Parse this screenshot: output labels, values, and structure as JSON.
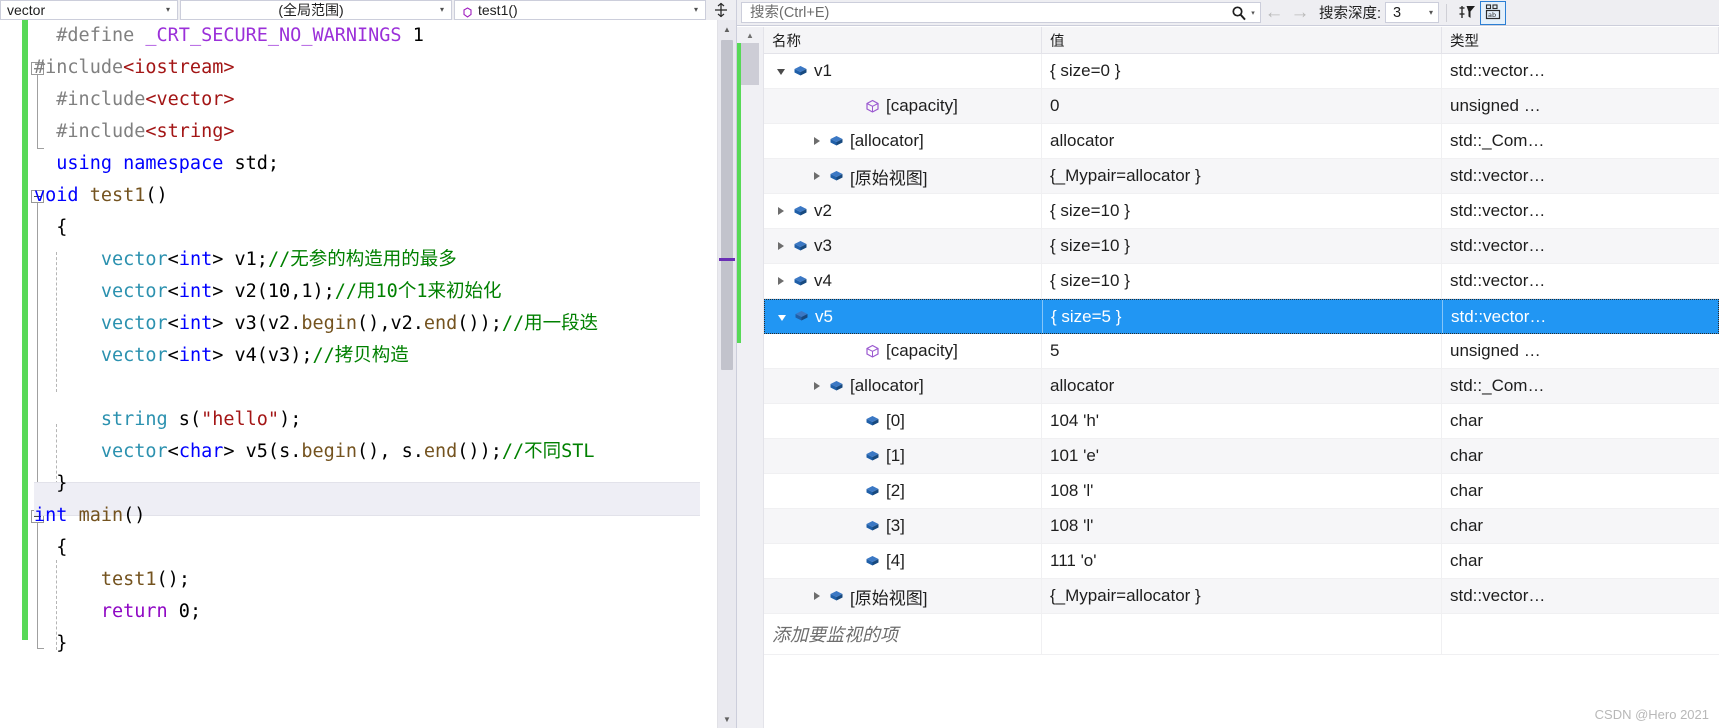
{
  "editor": {
    "nav": {
      "scope_project": "vector",
      "scope_class": "(全局范围)",
      "scope_member": "test1()",
      "dropdown_glyph": "▾",
      "split_glyph": "⇵"
    },
    "lines": [
      {
        "indent": 1,
        "tokens": [
          {
            "t": "#define ",
            "c": "t-pp"
          },
          {
            "t": "_CRT_SECURE_NO_WARNINGS",
            "c": "t-macro"
          },
          {
            "t": " 1",
            "c": "t-num"
          }
        ]
      },
      {
        "indent": 0,
        "tokens": [
          {
            "t": "#include",
            "c": "t-pp"
          },
          {
            "t": "<iostream>",
            "c": "t-hdr"
          }
        ]
      },
      {
        "indent": 1,
        "tokens": [
          {
            "t": "#include",
            "c": "t-pp"
          },
          {
            "t": "<vector>",
            "c": "t-hdr"
          }
        ]
      },
      {
        "indent": 1,
        "tokens": [
          {
            "t": "#include",
            "c": "t-pp"
          },
          {
            "t": "<string>",
            "c": "t-hdr"
          }
        ]
      },
      {
        "indent": 1,
        "tokens": [
          {
            "t": "using namespace",
            "c": "t-kw"
          },
          {
            "t": " std;",
            "c": "t-plain"
          }
        ]
      },
      {
        "indent": 0,
        "tokens": [
          {
            "t": "void",
            "c": "t-kw"
          },
          {
            "t": " ",
            "c": "t-plain"
          },
          {
            "t": "test1",
            "c": "t-fn"
          },
          {
            "t": "()",
            "c": "t-plain"
          }
        ]
      },
      {
        "indent": 1,
        "tokens": [
          {
            "t": "{",
            "c": "t-plain"
          }
        ]
      },
      {
        "indent": 1,
        "tokens": [
          {
            "t": "    ",
            "c": "t-plain"
          },
          {
            "t": "vector",
            "c": "t-type"
          },
          {
            "t": "<",
            "c": "t-plain"
          },
          {
            "t": "int",
            "c": "t-kw"
          },
          {
            "t": "> v1;",
            "c": "t-plain"
          },
          {
            "t": "//无参的构造用的最多",
            "c": "t-cmt"
          }
        ]
      },
      {
        "indent": 1,
        "tokens": [
          {
            "t": "    ",
            "c": "t-plain"
          },
          {
            "t": "vector",
            "c": "t-type"
          },
          {
            "t": "<",
            "c": "t-plain"
          },
          {
            "t": "int",
            "c": "t-kw"
          },
          {
            "t": "> v2(10,1);",
            "c": "t-plain"
          },
          {
            "t": "//用10个1来初始化",
            "c": "t-cmt"
          }
        ]
      },
      {
        "indent": 1,
        "tokens": [
          {
            "t": "    ",
            "c": "t-plain"
          },
          {
            "t": "vector",
            "c": "t-type"
          },
          {
            "t": "<",
            "c": "t-plain"
          },
          {
            "t": "int",
            "c": "t-kw"
          },
          {
            "t": "> v3(v2.",
            "c": "t-plain"
          },
          {
            "t": "begin",
            "c": "t-fn"
          },
          {
            "t": "(),v2.",
            "c": "t-plain"
          },
          {
            "t": "end",
            "c": "t-fn"
          },
          {
            "t": "());",
            "c": "t-plain"
          },
          {
            "t": "//用一段迭",
            "c": "t-cmt"
          }
        ]
      },
      {
        "indent": 1,
        "tokens": [
          {
            "t": "    ",
            "c": "t-plain"
          },
          {
            "t": "vector",
            "c": "t-type"
          },
          {
            "t": "<",
            "c": "t-plain"
          },
          {
            "t": "int",
            "c": "t-kw"
          },
          {
            "t": "> v4(v3);",
            "c": "t-plain"
          },
          {
            "t": "//拷贝构造",
            "c": "t-cmt"
          }
        ]
      },
      {
        "indent": 1,
        "tokens": []
      },
      {
        "indent": 1,
        "tokens": [
          {
            "t": "    ",
            "c": "t-plain"
          },
          {
            "t": "string",
            "c": "t-type"
          },
          {
            "t": " s(",
            "c": "t-plain"
          },
          {
            "t": "\"hello\"",
            "c": "t-str"
          },
          {
            "t": ");",
            "c": "t-plain"
          }
        ]
      },
      {
        "indent": 1,
        "tokens": [
          {
            "t": "    ",
            "c": "t-plain"
          },
          {
            "t": "vector",
            "c": "t-type"
          },
          {
            "t": "<",
            "c": "t-plain"
          },
          {
            "t": "char",
            "c": "t-kw"
          },
          {
            "t": "> v5(s.",
            "c": "t-plain"
          },
          {
            "t": "begin",
            "c": "t-fn"
          },
          {
            "t": "(), s.",
            "c": "t-plain"
          },
          {
            "t": "end",
            "c": "t-fn"
          },
          {
            "t": "());",
            "c": "t-plain"
          },
          {
            "t": "//不同STL",
            "c": "t-cmt"
          }
        ]
      },
      {
        "indent": 1,
        "tokens": [
          {
            "t": "}",
            "c": "t-plain"
          }
        ]
      },
      {
        "indent": 0,
        "tokens": [
          {
            "t": "int",
            "c": "t-kw"
          },
          {
            "t": " ",
            "c": "t-plain"
          },
          {
            "t": "main",
            "c": "t-fn"
          },
          {
            "t": "()",
            "c": "t-plain"
          }
        ]
      },
      {
        "indent": 1,
        "tokens": [
          {
            "t": "{",
            "c": "t-plain"
          }
        ]
      },
      {
        "indent": 1,
        "tokens": [
          {
            "t": "    ",
            "c": "t-plain"
          },
          {
            "t": "test1",
            "c": "t-fn"
          },
          {
            "t": "();",
            "c": "t-plain"
          }
        ]
      },
      {
        "indent": 1,
        "tokens": [
          {
            "t": "    ",
            "c": "t-plain"
          },
          {
            "t": "return",
            "c": "t-ret"
          },
          {
            "t": " 0;",
            "c": "t-plain"
          }
        ]
      },
      {
        "indent": 1,
        "tokens": [
          {
            "t": "}",
            "c": "t-plain"
          }
        ]
      }
    ],
    "scrollbar": {
      "up_glyph": "▲",
      "down_glyph": "▼"
    }
  },
  "watch": {
    "toolbar": {
      "search_placeholder": "搜索(Ctrl+E)",
      "search_value": "",
      "search_icon": "search-icon",
      "prev_glyph": "←",
      "next_glyph": "→",
      "depth_label": "搜索深度:",
      "depth_value": "3",
      "dropdown_glyph": "▾",
      "pin_filter_icon": "pin-filter-icon",
      "hex_tab_icon": "tab-display-icon"
    },
    "columns": {
      "name": "名称",
      "value": "值",
      "type": "类型"
    },
    "add_placeholder": "添加要监视的项",
    "watermark": "CSDN @Hero 2021",
    "rows": [
      {
        "indent": 1,
        "expander": "open",
        "icon": "field",
        "name": "v1",
        "value": "{ size=0 }",
        "type": "std::vector…",
        "selected": false
      },
      {
        "indent": 3,
        "expander": "none",
        "icon": "internal",
        "name": "[capacity]",
        "value": "0",
        "type": "unsigned …",
        "selected": false
      },
      {
        "indent": 2,
        "expander": "closed",
        "icon": "field",
        "name": "[allocator]",
        "value": "allocator",
        "type": "std::_Com…",
        "selected": false
      },
      {
        "indent": 2,
        "expander": "closed",
        "icon": "field",
        "name": "[原始视图]",
        "value": "{_Mypair=allocator }",
        "type": "std::vector…",
        "selected": false
      },
      {
        "indent": 1,
        "expander": "closed",
        "icon": "field",
        "name": "v2",
        "value": "{ size=10 }",
        "type": "std::vector…",
        "selected": false
      },
      {
        "indent": 1,
        "expander": "closed",
        "icon": "field",
        "name": "v3",
        "value": "{ size=10 }",
        "type": "std::vector…",
        "selected": false
      },
      {
        "indent": 1,
        "expander": "closed",
        "icon": "field",
        "name": "v4",
        "value": "{ size=10 }",
        "type": "std::vector…",
        "selected": false
      },
      {
        "indent": 1,
        "expander": "open",
        "icon": "field",
        "name": "v5",
        "value": "{ size=5 }",
        "type": "std::vector…",
        "selected": true
      },
      {
        "indent": 3,
        "expander": "none",
        "icon": "internal",
        "name": "[capacity]",
        "value": "5",
        "type": "unsigned …",
        "selected": false
      },
      {
        "indent": 2,
        "expander": "closed",
        "icon": "field",
        "name": "[allocator]",
        "value": "allocator",
        "type": "std::_Com…",
        "selected": false
      },
      {
        "indent": 3,
        "expander": "none",
        "icon": "field",
        "name": "[0]",
        "value": "104 'h'",
        "type": "char",
        "selected": false
      },
      {
        "indent": 3,
        "expander": "none",
        "icon": "field",
        "name": "[1]",
        "value": "101 'e'",
        "type": "char",
        "selected": false
      },
      {
        "indent": 3,
        "expander": "none",
        "icon": "field",
        "name": "[2]",
        "value": "108 'l'",
        "type": "char",
        "selected": false
      },
      {
        "indent": 3,
        "expander": "none",
        "icon": "field",
        "name": "[3]",
        "value": "108 'l'",
        "type": "char",
        "selected": false
      },
      {
        "indent": 3,
        "expander": "none",
        "icon": "field",
        "name": "[4]",
        "value": "111 'o'",
        "type": "char",
        "selected": false
      },
      {
        "indent": 2,
        "expander": "closed",
        "icon": "field",
        "name": "[原始视图]",
        "value": "{_Mypair=allocator }",
        "type": "std::vector…",
        "selected": false
      }
    ]
  },
  "colors": {
    "selection": "#2196f3",
    "change_bar": "#57d957",
    "comment": "#008000",
    "keyword": "#0000ff",
    "type": "#2b91af",
    "string": "#a31515",
    "macro": "#9b30d9",
    "function": "#74531f",
    "return_kw": "#8f08c4",
    "chrome": "#eeeef2"
  }
}
